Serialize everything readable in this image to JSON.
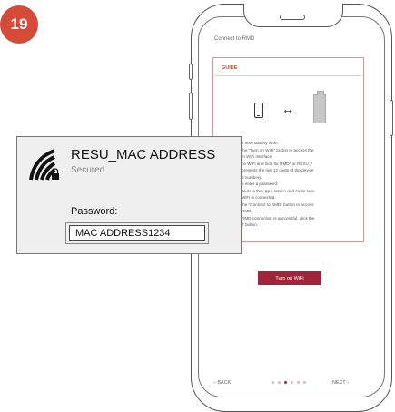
{
  "step_badge": "19",
  "phone": {
    "screen_title": "Connect to RMD",
    "guide": {
      "label": "GUIDE",
      "steps": [
        "e sure Battery is on.",
        "the \"Turn on WiFi\" button to access the",
        "m WiFi interface.",
        "on WiFi and look for RMD* or RESU_*",
        "presents the last 12 digits of the device",
        "d number).",
        "e enter a password.",
        "back to the Apps screen and make sure",
        "WiFi is connected.",
        "the \"Connect to RMD\" button to access",
        "RMD.",
        "RMD connection is successful, click the",
        "T button."
      ]
    },
    "wifi_button": "Turn on WiFi",
    "nav": {
      "back": "‹  BACK",
      "next": "NEXT  ›"
    },
    "pager": {
      "count": 6,
      "active": 2
    }
  },
  "wifi_popup": {
    "ssid": "RESU_MAC ADDRESS",
    "status": "Secured",
    "password_label": "Password:",
    "password_value": "MAC ADDRESS1234",
    "icon": "wifi-locked-icon"
  },
  "colors": {
    "accent": "#a0253a",
    "badge": "#d64a3a"
  }
}
